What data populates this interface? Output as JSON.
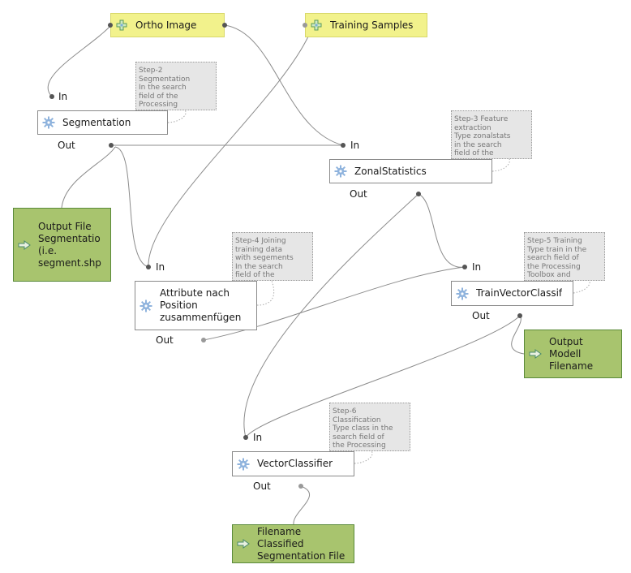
{
  "inputs": [
    {
      "id": "ortho",
      "label": "Ortho Image",
      "icon": "add-input-icon"
    },
    {
      "id": "training",
      "label": "Training Samples",
      "icon": "add-input-icon"
    }
  ],
  "algorithms": [
    {
      "id": "segmentation",
      "label": "Segmentation",
      "in_label": "In",
      "out_label": "Out",
      "icon": "gear-icon"
    },
    {
      "id": "zonalstats",
      "label": "ZonalStatistics",
      "in_label": "In",
      "out_label": "Out",
      "icon": "gear-icon"
    },
    {
      "id": "attrjoin",
      "label": "Attribute nach\nPosition\nzusammenfügen",
      "in_label": "In",
      "out_label": "Out",
      "icon": "gear-icon"
    },
    {
      "id": "train",
      "label": "TrainVectorClassif",
      "in_label": "In",
      "out_label": "Out",
      "icon": "gear-icon"
    },
    {
      "id": "classifier",
      "label": "VectorClassifier",
      "in_label": "In",
      "out_label": "Out",
      "icon": "gear-icon"
    }
  ],
  "outputs": [
    {
      "id": "out_seg",
      "label": "Output File\nSegmentatio\n(i.e.\nsegment.shp",
      "icon": "output-arrow-icon"
    },
    {
      "id": "out_model",
      "label": "Output\nModell\nFilename",
      "icon": "output-arrow-icon"
    },
    {
      "id": "out_class",
      "label": "Filename\nClassified\nSegmentation File",
      "icon": "output-arrow-icon"
    }
  ],
  "comments": [
    {
      "id": "c2",
      "text": "Step-2\nSegmentation\nIn the search\nfield of the\nProcessing"
    },
    {
      "id": "c3",
      "text": "Step-3 Feature\nextraction\nType zonalstats\nin the search\nfield of the"
    },
    {
      "id": "c4",
      "text": "Step-4 Joining\ntraining data\nwith segements\nIn the search\nfield of the"
    },
    {
      "id": "c5",
      "text": "Step-5 Training\nType train in the\nsearch field of\nthe Processing\nToolbox and"
    },
    {
      "id": "c6",
      "text": "Step-6\nClassification\nType class in the\nsearch field of\nthe Processing"
    }
  ],
  "colors": {
    "input_fill": "#f2f28c",
    "output_fill": "#a8c46e",
    "comment_fill": "#e6e6e6",
    "wire": "#8c8c8c"
  }
}
